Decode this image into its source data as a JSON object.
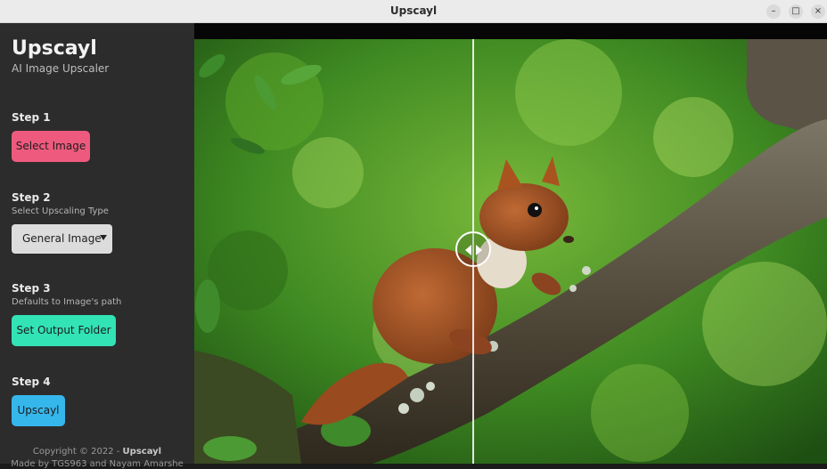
{
  "window": {
    "title": "Upscayl",
    "controls": {
      "minimize": "–",
      "maximize": "□",
      "close": "×"
    }
  },
  "sidebar": {
    "app_title": "Upscayl",
    "app_subtitle": "AI Image Upscaler",
    "step1": {
      "label": "Step 1",
      "button": "Select Image"
    },
    "step2": {
      "label": "Step 2",
      "hint": "Select Upscaling Type",
      "selected": "General Image"
    },
    "step3": {
      "label": "Step 3",
      "hint": "Defaults to Image's path",
      "button": "Set Output Folder"
    },
    "step4": {
      "label": "Step 4",
      "button": "Upscayl"
    },
    "footer": {
      "line1_prefix": "Copyright © 2022 - ",
      "line1_brand": "Upscayl",
      "line2": "Made by TGS963 and Nayam Amarshe"
    }
  },
  "preview": {
    "subject": "squirrel on tree branch",
    "compare_icon": "compare-slider-icon"
  },
  "colors": {
    "select_button": "#ee5a7e",
    "output_button": "#32e3b6",
    "upscayl_button": "#35b7ec",
    "sidebar_bg": "#2c2c2c"
  }
}
